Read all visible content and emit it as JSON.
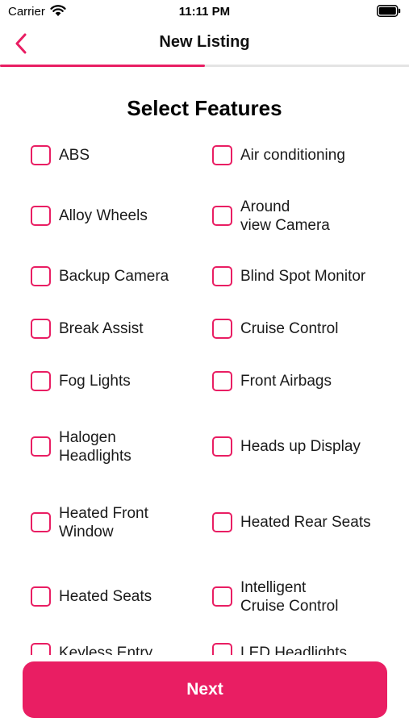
{
  "status_bar": {
    "carrier": "Carrier",
    "time": "11:11 PM"
  },
  "nav": {
    "title": "New Listing",
    "progress": 0.5
  },
  "accent_color": "#e91e63",
  "section_title": "Select Features",
  "features": [
    [
      "ABS",
      "Air conditioning"
    ],
    [
      "Alloy Wheels",
      "Around\nview Camera"
    ],
    [
      "Backup Camera",
      "Blind Spot Monitor"
    ],
    [
      "Break Assist",
      "Cruise Control"
    ],
    [
      "Fog Lights",
      "Front Airbags"
    ],
    [
      "Halogen\nHeadlights",
      "Heads up Display"
    ],
    [
      "Heated Front\nWindow",
      "Heated Rear Seats"
    ],
    [
      "Heated Seats",
      "Intelligent\nCruise Control"
    ],
    [
      "Keyless Entry",
      "LED Headlights"
    ]
  ],
  "next_button": {
    "label": "Next"
  }
}
